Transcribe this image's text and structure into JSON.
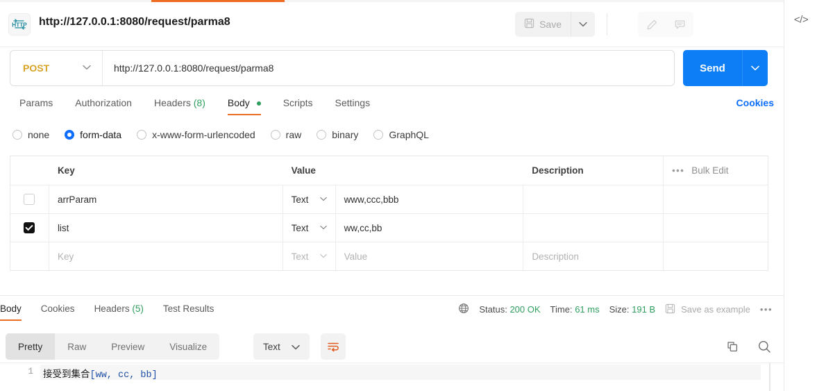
{
  "tabstrip": {
    "active_tab_accent": "#ef6c23"
  },
  "request_header": {
    "protocol_badge": "HTTP",
    "title": "http://127.0.0.1:8080/request/parma8",
    "save_label": "Save",
    "save_caret": "⌄",
    "edit_icon": "pencil-icon",
    "comment_icon": "comment-icon",
    "code_icon": "</>"
  },
  "url_bar": {
    "method": "POST",
    "method_caret": "⌄",
    "url": "http://127.0.0.1:8080/request/parma8",
    "send_label": "Send",
    "send_caret": "⌄",
    "method_color": "#d9a326",
    "send_color": "#0d7ef5"
  },
  "request_tabs": {
    "items": [
      {
        "label": "Params",
        "count": "",
        "dot": false,
        "active": false
      },
      {
        "label": "Authorization",
        "count": "",
        "dot": false,
        "active": false
      },
      {
        "label": "Headers",
        "count": "(8)",
        "dot": false,
        "active": false
      },
      {
        "label": "Body",
        "count": "",
        "dot": true,
        "active": true
      },
      {
        "label": "Scripts",
        "count": "",
        "dot": false,
        "active": false
      },
      {
        "label": "Settings",
        "count": "",
        "dot": false,
        "active": false
      }
    ],
    "cookies_label": "Cookies"
  },
  "body_types": {
    "options": [
      {
        "label": "none",
        "selected": false
      },
      {
        "label": "form-data",
        "selected": true
      },
      {
        "label": "x-www-form-urlencoded",
        "selected": false
      },
      {
        "label": "raw",
        "selected": false
      },
      {
        "label": "binary",
        "selected": false
      },
      {
        "label": "GraphQL",
        "selected": false
      }
    ]
  },
  "form_table": {
    "headers": {
      "key": "Key",
      "value": "Value",
      "description": "Description",
      "bulk_edit": "Bulk Edit",
      "bulk_dots": "•••"
    },
    "rows": [
      {
        "checked": false,
        "key": "arrParam",
        "type": "Text",
        "value": "www,ccc,bbb",
        "description": "",
        "is_placeholder": false
      },
      {
        "checked": true,
        "key": "list",
        "type": "Text",
        "value": "ww,cc,bb",
        "description": "",
        "is_placeholder": false
      },
      {
        "checked": false,
        "key": "Key",
        "type": "Text",
        "value": "Value",
        "description": "Description",
        "is_placeholder": true
      }
    ]
  },
  "response_tabs": {
    "items": [
      {
        "label": "Body",
        "count": "",
        "active": true
      },
      {
        "label": "Cookies",
        "count": "",
        "active": false
      },
      {
        "label": "Headers",
        "count": "(5)",
        "active": false
      },
      {
        "label": "Test Results",
        "count": "",
        "active": false
      }
    ],
    "globe_icon": "globe-icon",
    "status_label": "Status:",
    "status_value": "200 OK",
    "time_label": "Time:",
    "time_value": "61 ms",
    "size_label": "Size:",
    "size_value": "191 B",
    "save_example_label": "Save as example",
    "more_dots": "•••",
    "ok_color": "#2f9e5e"
  },
  "response_toolbar": {
    "views": [
      {
        "label": "Pretty",
        "active": true
      },
      {
        "label": "Raw",
        "active": false
      },
      {
        "label": "Preview",
        "active": false
      },
      {
        "label": "Visualize",
        "active": false
      }
    ],
    "format": "Text",
    "format_caret": "⌄",
    "wrap_icon": "word-wrap-icon",
    "copy_icon": "copy-icon",
    "search_icon": "search-icon"
  },
  "response_body": {
    "line_number": "1",
    "text_cn": "接受到集合",
    "text_code": "[ww, cc, bb]"
  }
}
